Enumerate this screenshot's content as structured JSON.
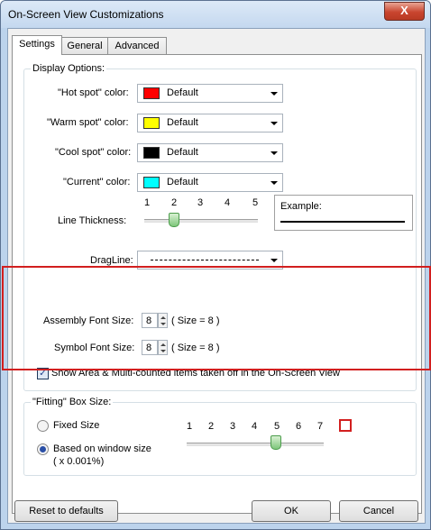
{
  "window": {
    "title": "On-Screen View Customizations",
    "close_glyph": "X"
  },
  "tabs": [
    {
      "label": "Settings"
    },
    {
      "label": "General"
    },
    {
      "label": "Advanced"
    }
  ],
  "display_options": {
    "title": "Display Options:",
    "colors": [
      {
        "label": "\"Hot spot\" color:",
        "value": "Default",
        "swatch": "#ff0000"
      },
      {
        "label": "\"Warm spot\" color:",
        "value": "Default",
        "swatch": "#ffff00"
      },
      {
        "label": "\"Cool spot\" color:",
        "value": "Default",
        "swatch": "#000000"
      },
      {
        "label": "\"Current\" color:",
        "value": "Default",
        "swatch": "#00ffff"
      }
    ],
    "line_thickness": {
      "label": "Line Thickness:",
      "ticks": [
        "1",
        "2",
        "3",
        "4",
        "5"
      ],
      "value": 2
    },
    "example_label": "Example:",
    "dragline_label": "DragLine:"
  },
  "fonts": {
    "assembly": {
      "label": "Assembly Font Size:",
      "value": "8",
      "note": "( Size = 8 )"
    },
    "symbol": {
      "label": "Symbol Font Size:",
      "value": "8",
      "note": "( Size = 8 )"
    },
    "show_area": {
      "label": "Show Area & Multi-counted items taken off in the On-Screen View",
      "checked": true
    }
  },
  "fitting": {
    "title": "\"Fitting\" Box Size:",
    "fixed_label": "Fixed Size",
    "based_label": "Based on window size",
    "based_sub": "( x 0.001%)",
    "ticks": [
      "1",
      "2",
      "3",
      "4",
      "5",
      "6",
      "7"
    ],
    "value": 5,
    "selected": "based"
  },
  "buttons": {
    "reset": "Reset to defaults",
    "ok": "OK",
    "cancel": "Cancel"
  },
  "colors": {
    "highlight": "#d21f1f",
    "slider_thumb": "#7ec67b"
  }
}
